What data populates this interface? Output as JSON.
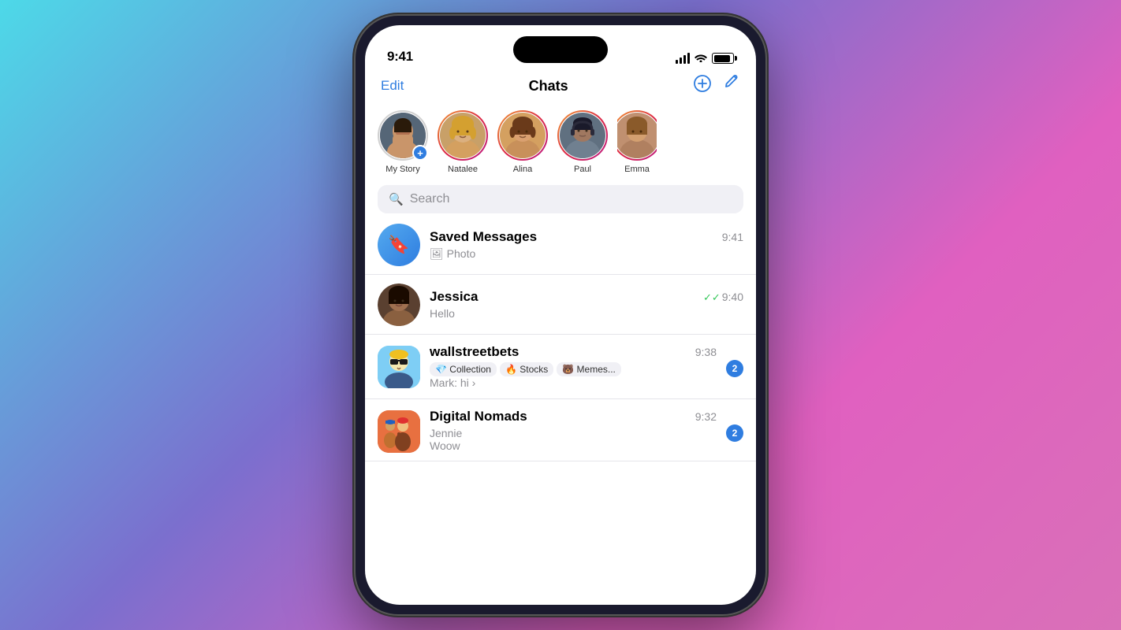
{
  "background": {
    "gradient": "linear-gradient(135deg, #4dd9e8 0%, #7b6fce 40%, #e060c0 70%, #d970b8 100%)"
  },
  "statusBar": {
    "time": "9:41",
    "icons": [
      "signal",
      "wifi",
      "battery"
    ]
  },
  "header": {
    "editLabel": "Edit",
    "title": "Chats",
    "addIcon": "⊕",
    "editIcon": "✎"
  },
  "stories": [
    {
      "id": "my-story",
      "label": "My Story",
      "hasAdd": true,
      "hasRing": false,
      "color": "#667788"
    },
    {
      "id": "natalee",
      "label": "Natalee",
      "hasAdd": false,
      "hasRing": true,
      "color": "#c8a068"
    },
    {
      "id": "alina",
      "label": "Alina",
      "hasAdd": false,
      "hasRing": true,
      "color": "#d4a060"
    },
    {
      "id": "paul",
      "label": "Paul",
      "hasAdd": false,
      "hasRing": true,
      "color": "#607080"
    },
    {
      "id": "emma",
      "label": "Emma",
      "hasAdd": false,
      "hasRing": true,
      "color": "#c09070"
    }
  ],
  "search": {
    "placeholder": "Search"
  },
  "chats": [
    {
      "id": "saved-messages",
      "name": "Saved Messages",
      "time": "9:41",
      "preview": "🖼 Photo",
      "avatarType": "saved",
      "badge": null,
      "read": true
    },
    {
      "id": "jessica",
      "name": "Jessica",
      "time": "9:40",
      "preview": "Hello",
      "avatarType": "jessica",
      "badge": null,
      "read": true,
      "sent": true
    },
    {
      "id": "wallstreetbets",
      "name": "wallstreetbets",
      "time": "9:38",
      "topics": [
        "💎 Collection",
        "🔥 Stocks",
        "🐻 Memes..."
      ],
      "preview2": "Mark: hi ›",
      "avatarType": "wsb",
      "badge": "2",
      "read": false
    },
    {
      "id": "digital-nomads",
      "name": "Digital Nomads",
      "time": "9:32",
      "preview": "Jennie",
      "preview2": "Woow",
      "avatarType": "nomads",
      "badge": "2",
      "read": false
    }
  ]
}
